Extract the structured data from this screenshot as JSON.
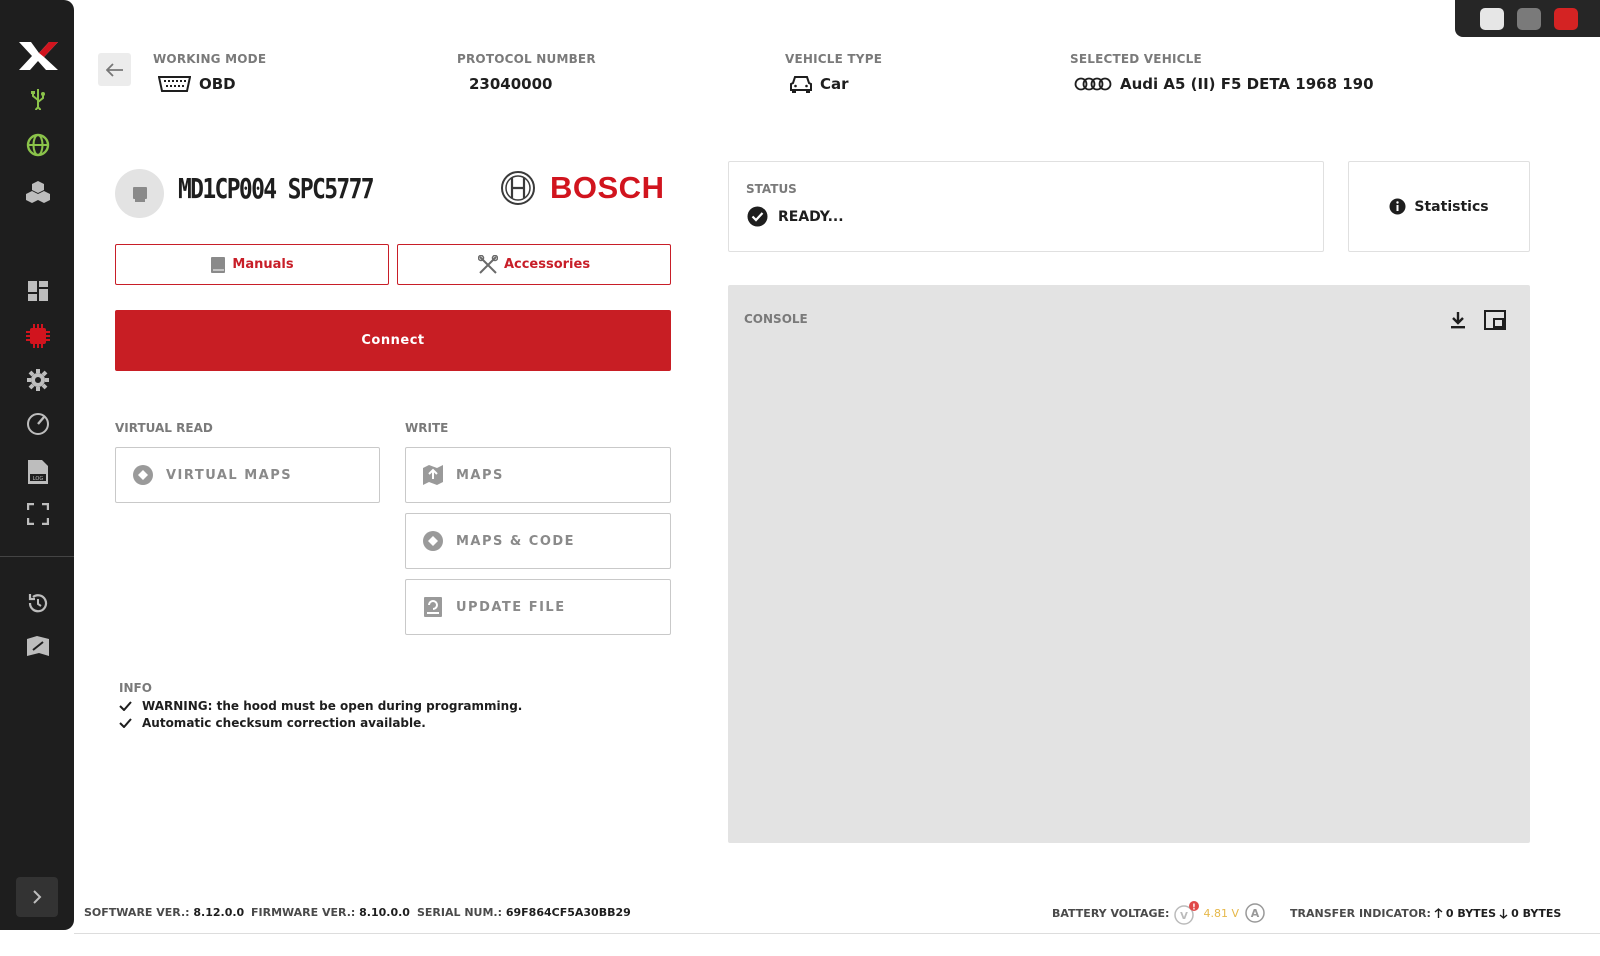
{
  "window": {
    "controls": [
      "minimize",
      "maximize",
      "close"
    ],
    "close_color": "#d42323"
  },
  "sidebar": {
    "logo": "x-logo",
    "items": [
      {
        "icon": "usb-icon",
        "color": "#8bc34a"
      },
      {
        "icon": "globe-icon",
        "color": "#8bc34a"
      },
      {
        "icon": "cubes-icon"
      },
      {
        "icon": "dashboard-icon"
      },
      {
        "icon": "chip-icon",
        "color": "#d1141e",
        "active": true
      },
      {
        "icon": "gear-icon"
      },
      {
        "icon": "gauge-icon"
      },
      {
        "icon": "log-file-icon"
      },
      {
        "icon": "fullscreen-icon"
      },
      {
        "icon": "history-icon"
      },
      {
        "icon": "flag-icon"
      }
    ]
  },
  "header": {
    "working_mode": {
      "label": "WORKING MODE",
      "value": "OBD"
    },
    "protocol": {
      "label": "PROTOCOL NUMBER",
      "value": "23040000"
    },
    "vehicle_type": {
      "label": "VEHICLE TYPE",
      "value": "Car"
    },
    "selected_vehicle": {
      "label": "SELECTED VEHICLE",
      "value": "Audi A5 (II) F5 DETA 1968 190"
    }
  },
  "ecu": {
    "name": "MD1CP004 SPC5777",
    "brand": "BOSCH",
    "brand_color": "#d1141e"
  },
  "buttons": {
    "manuals": "Manuals",
    "accessories": "Accessories",
    "connect": "Connect"
  },
  "virtual_read": {
    "label": "VIRTUAL READ",
    "items": [
      "VIRTUAL MAPS"
    ]
  },
  "write": {
    "label": "WRITE",
    "items": [
      "MAPS",
      "MAPS & CODE",
      "UPDATE FILE"
    ]
  },
  "info": {
    "label": "INFO",
    "lines": [
      "WARNING: the hood must be open during programming.",
      "Automatic checksum correction available."
    ]
  },
  "status": {
    "label": "STATUS",
    "value": "READY..."
  },
  "statistics": {
    "label": "Statistics"
  },
  "console": {
    "label": "CONSOLE"
  },
  "footer": {
    "software_label": "SOFTWARE VER.:",
    "software": "8.12.0.0",
    "firmware_label": "FIRMWARE VER.:",
    "firmware": "8.10.0.0",
    "serial_label": "SERIAL NUM.:",
    "serial": "69F864CF5A30BB29",
    "battery_label": "BATTERY VOLTAGE:",
    "battery": "4.81 V",
    "battery_color": "#e6b84a",
    "transfer_label": "TRANSFER INDICATOR:",
    "upload": "0 BYTES",
    "download": "0 BYTES"
  }
}
